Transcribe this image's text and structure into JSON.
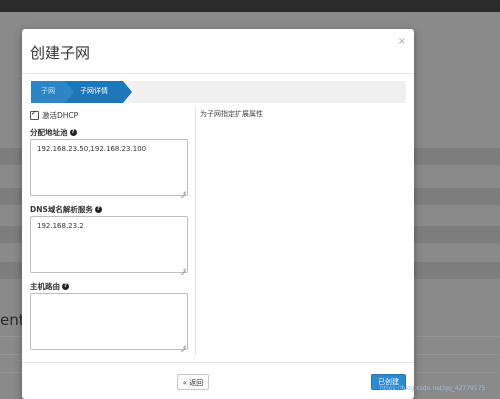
{
  "background": {
    "partial_text": "ents"
  },
  "modal": {
    "title": "创建子网",
    "close_icon": "×",
    "wizard": {
      "steps": [
        {
          "label": "子网"
        },
        {
          "label": "子网详情"
        }
      ]
    },
    "dhcp": {
      "label": "激活DHCP",
      "checked": true
    },
    "pools": {
      "label": "分配地址池",
      "value": "192.168.23.50,192.168.23.100"
    },
    "dns": {
      "label": "DNS域名解析服务",
      "value": "192.168.23.2"
    },
    "routes": {
      "label": "主机路由",
      "value": ""
    },
    "side_help": "为子网指定扩展属性",
    "buttons": {
      "back": "« 返回",
      "create": "已创建"
    }
  },
  "watermark": "https://blog.csdn.net/qq_42779175",
  "colors": {
    "primary": "#2f8bd0",
    "wizard_active": "#1e77b8",
    "wizard_done": "#2d85c6"
  }
}
